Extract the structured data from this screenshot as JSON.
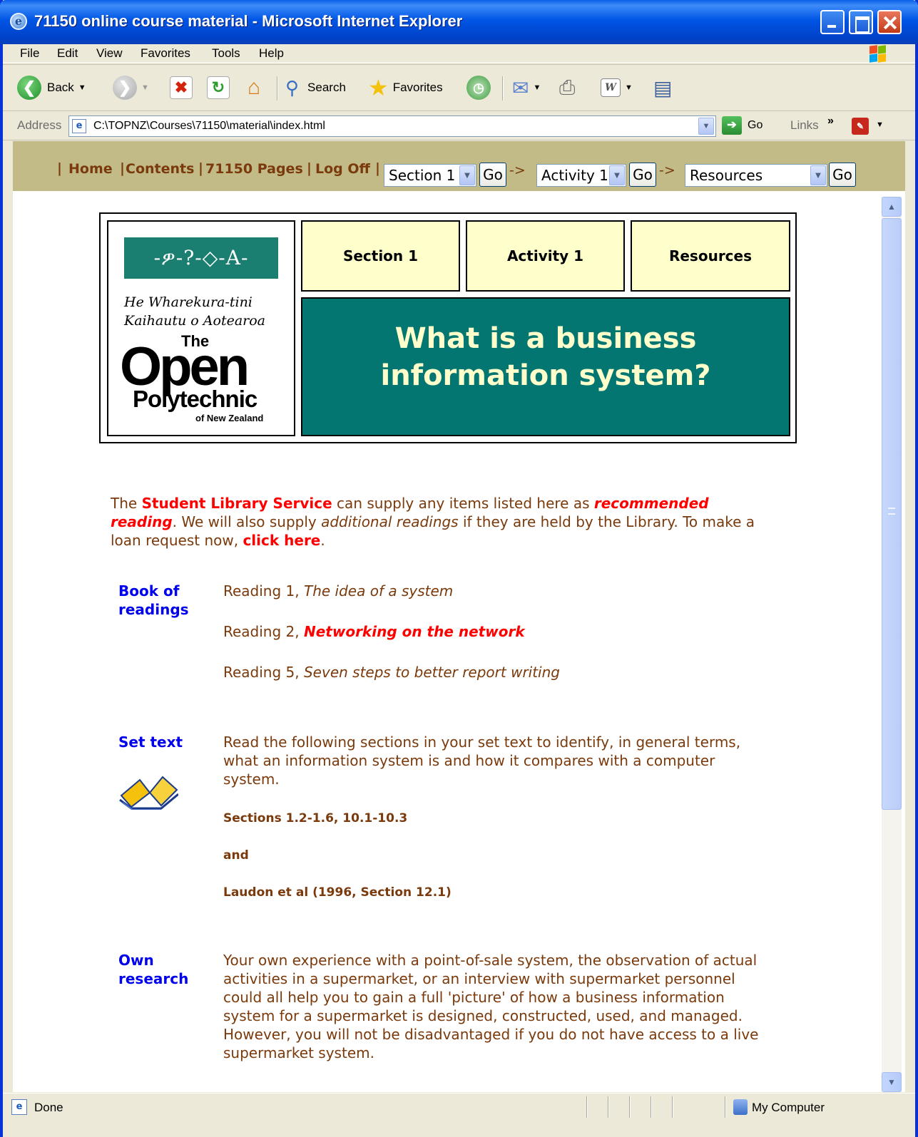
{
  "window": {
    "title": "71150 online course material - Microsoft Internet Explorer"
  },
  "menu": [
    "File",
    "Edit",
    "View",
    "Favorites",
    "Tools",
    "Help"
  ],
  "toolbar": {
    "back_label": "Back",
    "search_label": "Search",
    "favorites_label": "Favorites"
  },
  "address": {
    "label": "Address",
    "url": "C:\\TOPNZ\\Courses\\71150\\material\\index.html",
    "go_label": "Go",
    "links_label": "Links",
    "links_chevron": "»"
  },
  "nav": {
    "links": [
      "Home",
      "Contents",
      "71150 Pages",
      "Log Off"
    ],
    "section_select": "Section 1",
    "activity_select": "Activity 1",
    "resources_select": "Resources",
    "go_label": "Go",
    "arrow": "->"
  },
  "header": {
    "logo_band": "-ዎ-?-◇-A-",
    "logo_maori_line1": "He Wharekura-tini",
    "logo_maori_line2": "Kaihautu o Aotearoa",
    "logo_the": "The",
    "logo_open": "Open",
    "logo_polytechnic": "Polytechnic",
    "logo_nz": "of New Zealand",
    "cell_section": "Section 1",
    "cell_activity": "Activity 1",
    "cell_resources": "Resources",
    "title_line1": "What is a business",
    "title_line2": "information system?"
  },
  "intro": {
    "part1": "The ",
    "library": "Student Library Service",
    "part2": " can supply any items listed here as ",
    "recommended": "recommended reading",
    "part3": ". We will also supply ",
    "additional": "additional readings",
    "part4": " if they are held by the Library. To make a loan request now, ",
    "click_here": "click here",
    "part5": "."
  },
  "book_of_readings": {
    "label_line1": "Book of",
    "label_line2": "readings",
    "readings": [
      {
        "prefix": "Reading 1, ",
        "title": "The idea of a system"
      },
      {
        "prefix": "Reading 2, ",
        "title": "Networking on the network"
      },
      {
        "prefix": "Reading 5, ",
        "title": "Seven steps to better report writing"
      }
    ]
  },
  "set_text": {
    "label": "Set text",
    "paragraph": "Read the following sections in your set text to identify, in general terms, what an information system is and how it compares with a computer system.",
    "sections": "Sections 1.2-1.6, 10.1-10.3",
    "and": "and",
    "laudon": "Laudon et al (1996, Section 12.1)"
  },
  "own_research": {
    "label_line1": "Own",
    "label_line2": "research",
    "paragraph": "Your own experience with a point-of-sale system, the observation of actual activities in a supermarket, or an interview with supermarket personnel could all help you to gain a full 'picture' of how a business information system for a supermarket is designed, constructed, used, and managed. However, you will not be disadvantaged if you do not have access to a live supermarket system."
  },
  "status": {
    "left": "Done",
    "zone": "My Computer"
  },
  "colors": {
    "title_bar": "#0055e5",
    "nav_bg": "#c2bb88",
    "nav_text": "#7a3a0c",
    "header_yellow": "#ffffcc",
    "header_teal": "#037672",
    "link_red": "#ff0000",
    "label_blue": "#0000ee"
  }
}
